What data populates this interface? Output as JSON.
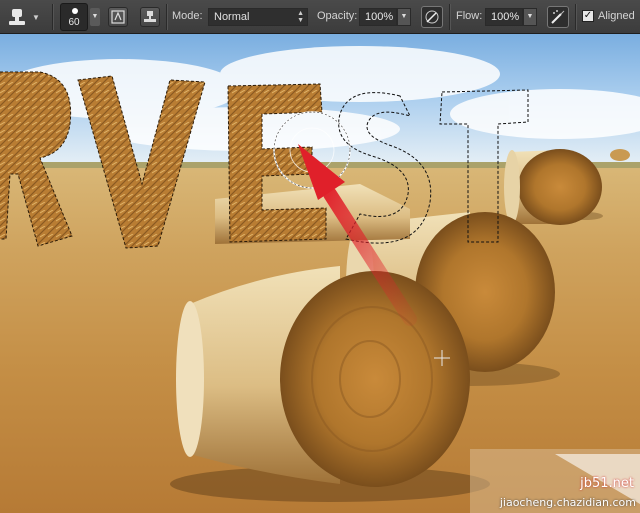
{
  "options_bar": {
    "tool": "clone-stamp",
    "brush_size": "60",
    "mode_label": "Mode:",
    "mode_value": "Normal",
    "opacity_label": "Opacity:",
    "opacity_value": "100%",
    "flow_label": "Flow:",
    "flow_value": "100%",
    "aligned_label": "Aligned",
    "aligned_checked": true
  },
  "canvas": {
    "text_letters": [
      "R",
      "V",
      "E",
      "S",
      "T"
    ],
    "filled_letters": [
      "R",
      "V",
      "E"
    ],
    "outlined_letters": [
      "S",
      "T"
    ],
    "colors": {
      "sky": "#8fbbe6",
      "hay": "#c98f3f",
      "arrow": "#e0202a",
      "toolbar": "#424242"
    }
  },
  "watermark": {
    "line1": "jb51.net",
    "line2": "jiaocheng.chazidian.com"
  }
}
